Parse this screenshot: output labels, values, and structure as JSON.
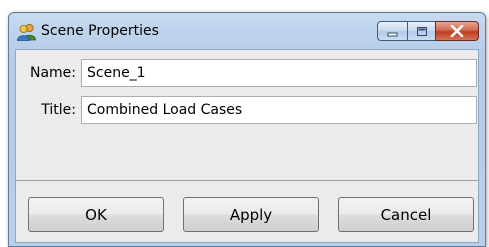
{
  "window": {
    "title": "Scene Properties"
  },
  "icons": {
    "app": "two-people-icon",
    "minimize": "minimize-icon",
    "maximize": "maximize-icon",
    "close": "close-icon"
  },
  "form": {
    "name_label": "Name:",
    "name_value": "Scene_1",
    "title_label": "Title:",
    "title_value": "Combined Load Cases"
  },
  "buttons": {
    "ok": "OK",
    "apply": "Apply",
    "cancel": "Cancel"
  },
  "colors": {
    "close_button": "#c94a2e",
    "titlebar": "#c6daf0"
  }
}
